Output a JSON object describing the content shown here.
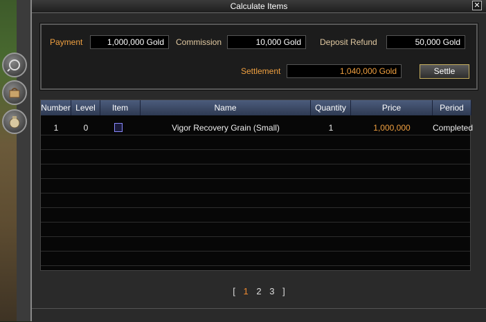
{
  "window": {
    "title": "Calculate Items",
    "close_glyph": "✕"
  },
  "settlement_panel": {
    "payment_label": "Payment",
    "payment_value": "1,000,000 Gold",
    "commission_label": "Commission",
    "commission_value": "10,000 Gold",
    "deposit_label": "Deposit Refund",
    "deposit_value": "50,000 Gold",
    "settlement_label": "Settlement",
    "settlement_value": "1,040,000 Gold",
    "settle_button": "Settle"
  },
  "table": {
    "columns": [
      "Number",
      "Level",
      "Item",
      "Name",
      "Quantity",
      "Price",
      "Period"
    ],
    "rows": [
      {
        "number": "1",
        "level": "0",
        "item_icon": "grain-item-icon",
        "name": "Vigor Recovery Grain (Small)",
        "quantity": "1",
        "price": "1,000,000",
        "period": "Completed"
      }
    ]
  },
  "pager": {
    "open": "[",
    "pages": [
      "1",
      "2",
      "3"
    ],
    "close": "]",
    "current": "1"
  },
  "colors": {
    "accent": "#f0a040",
    "header": "#3d4a66",
    "background": "#2a2a2a"
  },
  "sidebar": {
    "icons": [
      "magnifier-icon",
      "bag-icon",
      "money-bag-icon"
    ]
  }
}
